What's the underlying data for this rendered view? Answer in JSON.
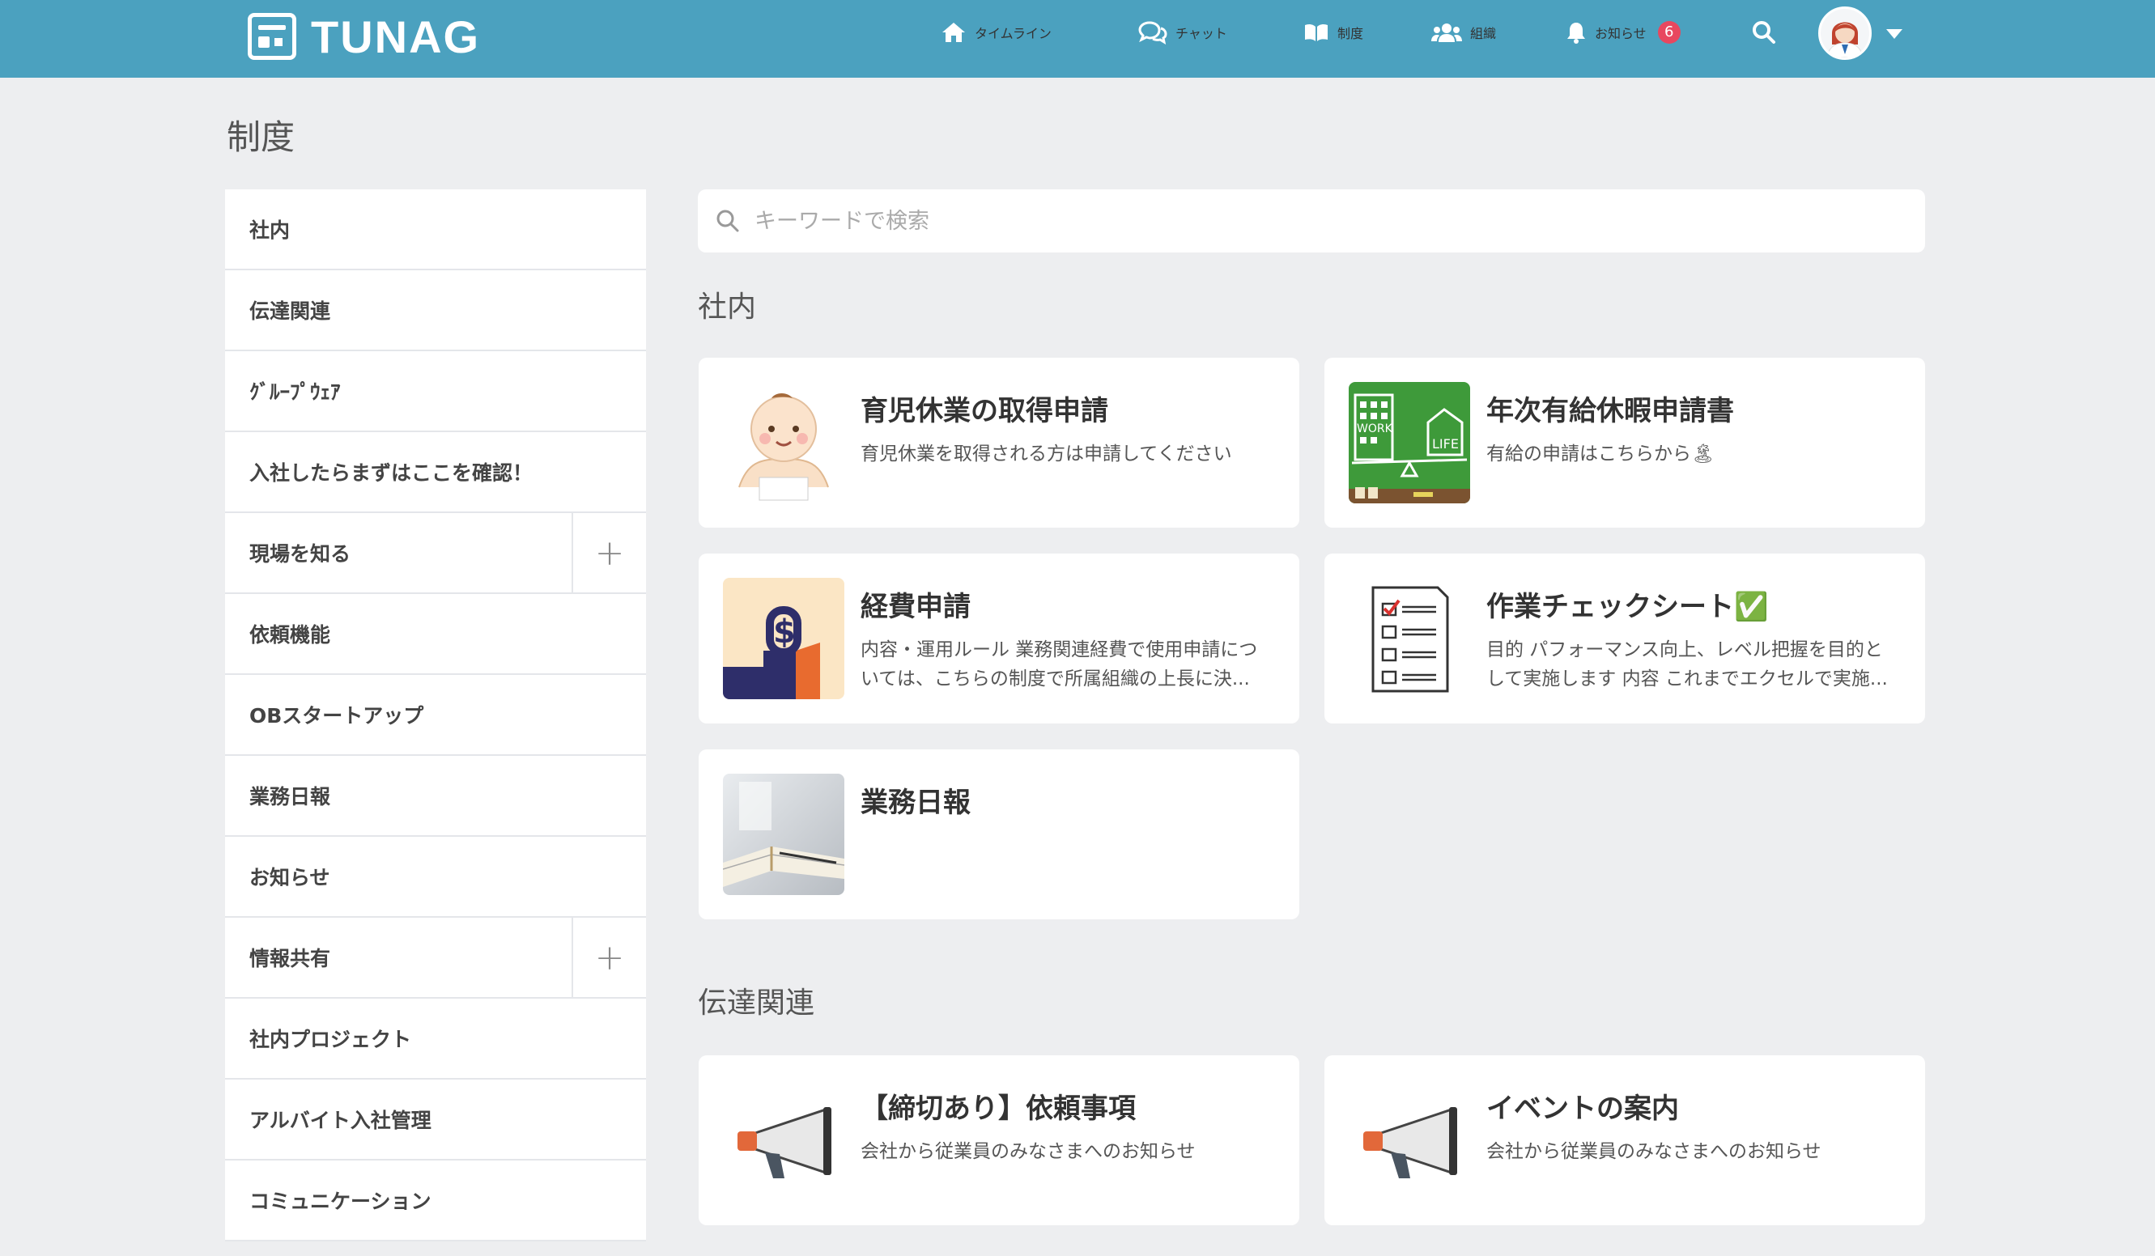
{
  "app": {
    "logo_text": "TUNAG"
  },
  "nav": {
    "timeline": "タイムライン",
    "chat": "チャット",
    "system": "制度",
    "organization": "組織",
    "notifications": "お知らせ",
    "notification_count": "6"
  },
  "page": {
    "title": "制度"
  },
  "sidebar": {
    "items": [
      {
        "label": "社内",
        "expandable": false
      },
      {
        "label": "伝達関連",
        "expandable": false
      },
      {
        "label": "ｸﾞﾙｰﾌﾟｳｪｱ",
        "expandable": false
      },
      {
        "label": "入社したらまずはここを確認！",
        "expandable": false
      },
      {
        "label": "現場を知る",
        "expandable": true
      },
      {
        "label": "依頼機能",
        "expandable": false
      },
      {
        "label": "OBスタートアップ",
        "expandable": false
      },
      {
        "label": "業務日報",
        "expandable": false
      },
      {
        "label": "お知らせ",
        "expandable": false
      },
      {
        "label": "情報共有",
        "expandable": true
      },
      {
        "label": "社内プロジェクト",
        "expandable": false
      },
      {
        "label": "アルバイト入社管理",
        "expandable": false
      },
      {
        "label": "コミュニケーション",
        "expandable": false
      }
    ],
    "plus_symbol": "+"
  },
  "search": {
    "placeholder": "キーワードで検索",
    "value": ""
  },
  "sections": [
    {
      "title": "社内",
      "cards": [
        {
          "title": "育児休業の取得申請",
          "desc": "育児休業を取得される方は申請してください",
          "icon": "baby-illustration"
        },
        {
          "title": "年次有給休暇申請書",
          "desc": "有給の申請はこちらから🏝",
          "icon": "work-life-balance-illustration"
        },
        {
          "title": "経費申請",
          "desc": "内容・運用ルール 業務関連経費で使用申請については、こちらの制度で所属組織の上長に決...",
          "icon": "dollar-lock-illustration"
        },
        {
          "title": "作業チェックシート✅",
          "desc": "目的 パフォーマンス向上、レベル把握を目的として実施します 内容 これまでエクセルで実施...",
          "icon": "checklist-illustration"
        },
        {
          "title": "業務日報",
          "desc": "",
          "icon": "notebook-photo"
        }
      ]
    },
    {
      "title": "伝達関連",
      "cards": [
        {
          "title": "【締切あり】依頼事項",
          "desc": "会社から従業員のみなさまへのお知らせ",
          "icon": "megaphone-illustration"
        },
        {
          "title": "イベントの案内",
          "desc": "会社から従業員のみなさまへのお知らせ",
          "icon": "megaphone-illustration"
        }
      ]
    }
  ],
  "colors": {
    "header": "#4ba1bf",
    "background": "#edeef0",
    "badge": "#e8475f"
  }
}
